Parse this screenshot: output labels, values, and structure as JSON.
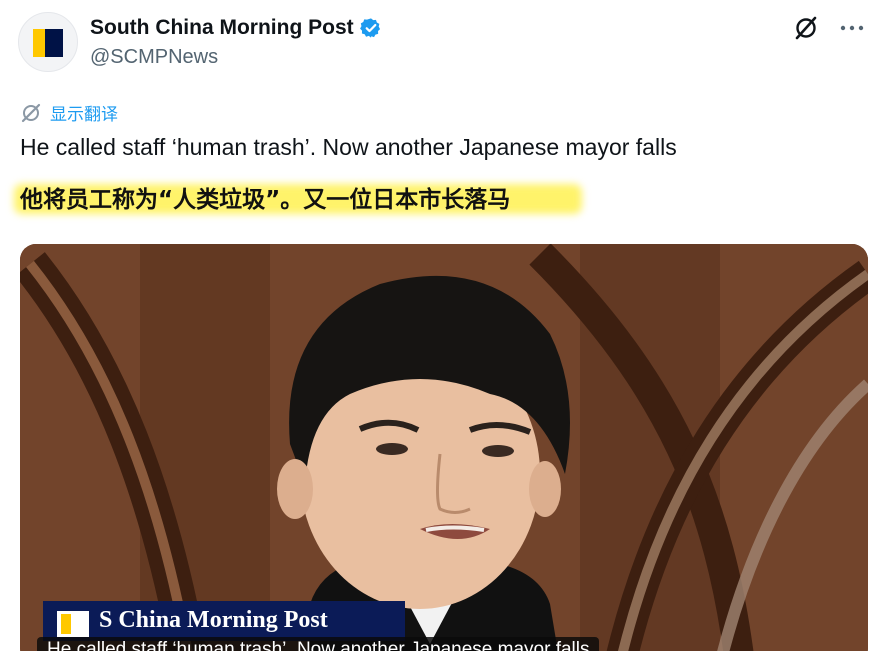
{
  "account": {
    "display_name": "South China Morning Post",
    "handle": "@SCMPNews",
    "verified": true,
    "avatar_icon": "scmp-logo-icon"
  },
  "actions": {
    "grok_icon": "grok-icon",
    "more_icon": "more-dots-icon",
    "more_label": "···"
  },
  "translate": {
    "icon": "translate-icon",
    "label": "显示翻译"
  },
  "tweet": {
    "text": "He called staff ‘human trash’. Now another Japanese mayor falls",
    "translation": "他将员工称为“人类垃圾”。又一位日本市长落马"
  },
  "media": {
    "overlay_logo_text": "S    China Morning Post",
    "caption": "He called staff ‘human trash’. Now another Japanese mayor falls"
  },
  "colors": {
    "link_blue": "#1d9bf0",
    "highlight": "#fff36a",
    "scmp_navy": "#0b1b57",
    "scmp_yellow": "#ffc800"
  }
}
